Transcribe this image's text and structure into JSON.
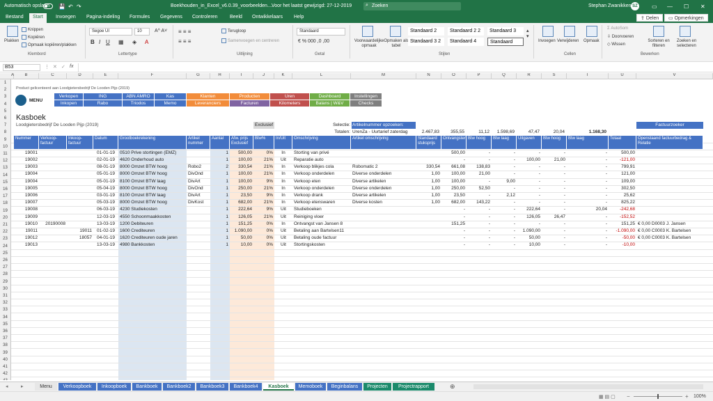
{
  "titlebar": {
    "autosave": "Automatisch opslaan",
    "filename": "Boekhouden_in_Excel_v6.0.39_voorbeelden....",
    "saved": "Voor het laatst gewijzigd: 27-12-2019",
    "search": "Zoeken",
    "user": "Stephan Zwanikken",
    "initials": "SZ"
  },
  "tabs": [
    "Bestand",
    "Start",
    "Invoegen",
    "Pagina-indeling",
    "Formules",
    "Gegevens",
    "Controleren",
    "Beeld",
    "Ontwikkelaars",
    "Help"
  ],
  "share_label": "Delen",
  "comments_label": "Opmerkingen",
  "ribbon": {
    "paste": "Plakken",
    "cut": "Knippen",
    "copy": "Kopiëren",
    "format_painter": "Opmaak kopiëren/plakken",
    "clipboard": "Klembord",
    "font_name": "Segoe UI",
    "font_size": "10",
    "font_group": "Lettertype",
    "wrap": "Terugloop",
    "merge": "Samenvoegen en centreren",
    "alignment_group": "Uitlijning",
    "number_format": "Standaard",
    "number_group": "Getal",
    "cond_format": "Voorwaardelijke opmaak",
    "format_table": "Opmaken als tabel",
    "styles": [
      "Standaard 2",
      "Standaard 2 2",
      "Standaard 3",
      "Standaard 3 2",
      "Standaard 4",
      "Standaard"
    ],
    "styles_group": "Stijlen",
    "insert": "Invoegen",
    "delete": "Verwijderen",
    "format": "Opmaak",
    "cells_group": "Cellen",
    "autosum": "AutoSom",
    "fill": "Doorvoeren",
    "clear": "Wissen",
    "sort": "Sorteren en filteren",
    "find": "Zoeken en selecteren",
    "editing_group": "Bewerken"
  },
  "namebox": "B53",
  "fx": "fx",
  "columns": [
    "A",
    "B",
    "C",
    "D",
    "E",
    "F",
    "G",
    "H",
    "I",
    "J",
    "K",
    "L",
    "M",
    "N",
    "O",
    "P",
    "Q",
    "R",
    "S",
    "T",
    "U",
    "V"
  ],
  "sheet": {
    "product_note": "Product gelicenteerd aan Loodgietersbedrijf De Looden Pijp (2019)",
    "menu_label": "MENU",
    "nav": [
      {
        "label": "Verkopen",
        "color": "#4472c4"
      },
      {
        "label": "ING",
        "color": "#4472c4"
      },
      {
        "label": "ABN AMRO",
        "color": "#4472c4"
      },
      {
        "label": "Kas",
        "color": "#4472c4"
      },
      {
        "label": "Klanten",
        "color": "#f28c3a"
      },
      {
        "label": "Producten",
        "color": "#f28c3a"
      },
      {
        "label": "Uren",
        "color": "#c0504d"
      },
      {
        "label": "Dashboard",
        "color": "#70ad47"
      },
      {
        "label": "Instellingen",
        "color": "#7f7f7f"
      },
      {
        "label": "Inkopen",
        "color": "#4472c4"
      },
      {
        "label": "Rabo",
        "color": "#4472c4"
      },
      {
        "label": "Triodos",
        "color": "#4472c4"
      },
      {
        "label": "Memo",
        "color": "#4472c4"
      },
      {
        "label": "Leveranciers",
        "color": "#f28c3a"
      },
      {
        "label": "Facturen",
        "color": "#8064a2"
      },
      {
        "label": "Kilometers",
        "color": "#c0504d"
      },
      {
        "label": "Balans | W&V",
        "color": "#70ad47"
      },
      {
        "label": "Checks",
        "color": "#7f7f7f"
      }
    ],
    "title": "Kasboek",
    "company": "Loodgietersbedrijf De Looden Pijp (2019)",
    "exclusief": "Exclusief",
    "selectie_label": "Selectie:",
    "selectie_value": "Artikelnummer opzoeken:",
    "totalen_label": "Totalen:",
    "totalen_value": "UrenZa - Uurtarief zaterdag",
    "totals": [
      "2.467,83",
      "355,55",
      "11,12",
      "1.598,69",
      "47,47",
      "20,04",
      "1.168,30"
    ],
    "factuurzoeker": "Factuurzoeker",
    "headers": [
      "Nummer",
      "Verkoop-factuur",
      "Inkoop-factuur",
      "Datum",
      "Grootboekrekening",
      "Artikel nummer",
      "Aantal",
      "Afw. prijs Exclusief",
      "Btw%",
      "In/Uit",
      "Omschrijving",
      "Artikel omschrijving",
      "Standaard stuksprijs",
      "Ontvangsten",
      "Btw hoog",
      "Btw laag",
      "Uitgaven",
      "Btw hoog",
      "Btw laag",
      "Totaal",
      "Openstaand factuurbedrag & Relatie"
    ],
    "rows": [
      [
        "19001",
        "",
        "",
        "01-01-19",
        "0510 Prive stortingen (EMZ)",
        "",
        "1",
        "500,00",
        "0%",
        "In",
        "Storting van privé",
        "",
        "",
        "500,00",
        "-",
        "-",
        "-",
        "-",
        "-",
        "500,00",
        ""
      ],
      [
        "19002",
        "",
        "",
        "02-01-19",
        "4620 Onderhoud auto",
        "",
        "1",
        "100,00",
        "21%",
        "Uit",
        "Reparatie auto",
        "",
        "",
        "-",
        "-",
        "-",
        "100,00",
        "21,00",
        "-",
        "-121,00",
        ""
      ],
      [
        "19003",
        "",
        "",
        "08-01-19",
        "8000 Omzet BTW hoog",
        "Robo2",
        "2",
        "330,54",
        "21%",
        "In",
        "Verkoop blikjes cola",
        "Robomatic 2",
        "330,54",
        "661,08",
        "138,83",
        "-",
        "-",
        "-",
        "-",
        "799,91",
        ""
      ],
      [
        "19004",
        "",
        "",
        "05-01-19",
        "8000 Omzet BTW hoog",
        "DivOnd",
        "1",
        "100,00",
        "21%",
        "In",
        "Verkoop onderdelen",
        "Diverse onderdelen",
        "1,00",
        "100,00",
        "21,00",
        "-",
        "-",
        "-",
        "-",
        "121,00",
        ""
      ],
      [
        "19004",
        "",
        "",
        "05-01-19",
        "8100 Omzet BTW laag",
        "DivArt",
        "1",
        "100,00",
        "9%",
        "In",
        "Verkoop eten",
        "Diverse artikelen",
        "1,00",
        "100,00",
        "-",
        "9,00",
        "-",
        "-",
        "-",
        "109,00",
        ""
      ],
      [
        "19005",
        "",
        "",
        "05-04-19",
        "8000 Omzet BTW hoog",
        "DivOnd",
        "1",
        "250,00",
        "21%",
        "In",
        "Verkoop onderdelen",
        "Diverse onderdelen",
        "1,00",
        "250,00",
        "52,50",
        "-",
        "-",
        "-",
        "-",
        "302,50",
        ""
      ],
      [
        "19006",
        "",
        "",
        "03-01-19",
        "8100 Omzet BTW laag",
        "DivArt",
        "1",
        "23,50",
        "9%",
        "In",
        "Verkoop drank",
        "Diverse artikelen",
        "1,00",
        "23,50",
        "-",
        "2,12",
        "-",
        "-",
        "-",
        "25,62",
        ""
      ],
      [
        "19007",
        "",
        "",
        "05-03-19",
        "8000 Omzet BTW hoog",
        "DivKost",
        "1",
        "682,00",
        "21%",
        "In",
        "Verkoop etenswaren",
        "Diverse kosten",
        "1,00",
        "682,00",
        "143,22",
        "-",
        "-",
        "-",
        "-",
        "825,22",
        ""
      ],
      [
        "19008",
        "",
        "",
        "06-03-19",
        "4230 Studiekosten",
        "",
        "1",
        "222,64",
        "9%",
        "Uit",
        "Studieboeken",
        "",
        "",
        "-",
        "-",
        "-",
        "222,64",
        "-",
        "20,04",
        "-242,68",
        ""
      ],
      [
        "19009",
        "",
        "",
        "12-03-19",
        "4550 Schoonmaakkosten",
        "",
        "1",
        "126,05",
        "21%",
        "Uit",
        "Reiniging vloer",
        "",
        "",
        "-",
        "-",
        "-",
        "126,05",
        "26,47",
        "-",
        "-152,52",
        ""
      ],
      [
        "19010",
        "20190008",
        "",
        "13-03-19",
        "1200 Debiteuren",
        "",
        "1",
        "151,25",
        "0%",
        "In",
        "Ontvangst van Jansen 8",
        "",
        "",
        "151,25",
        "-",
        "-",
        "-",
        "-",
        "-",
        "151,25",
        "€ 0,00 D0003 J. Jansen"
      ],
      [
        "19011",
        "",
        "19011",
        "01-02-19",
        "1600 Crediteuren",
        "",
        "1",
        "1.090,00",
        "0%",
        "Uit",
        "Betaling aan Bartelsen11",
        "",
        "",
        "-",
        "-",
        "-",
        "1.090,00",
        "-",
        "-",
        "-1.090,00",
        "€ 0,00 C0003 K. Bartelsen"
      ],
      [
        "19012",
        "",
        "18057",
        "04-01-19",
        "1620 Crediteuren oude jaren",
        "",
        "1",
        "50,00",
        "0%",
        "Uit",
        "Betaling oude factuur",
        "",
        "",
        "-",
        "-",
        "-",
        "50,00",
        "-",
        "-",
        "-50,00",
        "€ 0,00 C0003 K. Bartelsen"
      ],
      [
        "19013",
        "",
        "",
        "13-03-19",
        "4980 Bankkosten",
        "",
        "1",
        "10,00",
        "0%",
        "Uit",
        "Stortingskosten",
        "",
        "",
        "-",
        "-",
        "-",
        "10,00",
        "-",
        "-",
        "-10,00",
        ""
      ]
    ],
    "row_numbers": [
      "1",
      "2",
      "3",
      "4",
      "5",
      "6",
      "7",
      "8",
      "9",
      "10",
      "11",
      "12",
      "13",
      "14",
      "15",
      "16",
      "17",
      "18",
      "19",
      "20",
      "21",
      "22",
      "23",
      "24",
      "25",
      "26",
      "27",
      "28",
      "29",
      "30",
      "31",
      "32",
      "33",
      "34",
      "35",
      "36",
      "37",
      "38",
      "39",
      "40",
      "41",
      "42",
      "43",
      "44",
      "45",
      "46",
      "47"
    ]
  },
  "sheet_tabs": [
    {
      "label": "Menu",
      "color": "#e7e7e7",
      "text": "#333"
    },
    {
      "label": "Verkoopboek",
      "color": "#4472c4",
      "text": "#fff"
    },
    {
      "label": "Inkoopboek",
      "color": "#4472c4",
      "text": "#fff"
    },
    {
      "label": "Bankboek",
      "color": "#4472c4",
      "text": "#fff"
    },
    {
      "label": "Bankboek2",
      "color": "#4472c4",
      "text": "#fff"
    },
    {
      "label": "Bankboek3",
      "color": "#4472c4",
      "text": "#fff"
    },
    {
      "label": "Bankboek4",
      "color": "#4472c4",
      "text": "#fff"
    },
    {
      "label": "Kasboek",
      "color": "#ffffff",
      "text": "#217346"
    },
    {
      "label": "Memoboek",
      "color": "#4472c4",
      "text": "#fff"
    },
    {
      "label": "Beginbalans",
      "color": "#4472c4",
      "text": "#fff"
    },
    {
      "label": "Projecten",
      "color": "#1b8a6b",
      "text": "#fff"
    },
    {
      "label": "Projectrapport",
      "color": "#1b8a6b",
      "text": "#fff"
    }
  ],
  "status": {
    "zoom": "100%"
  },
  "colors": {
    "accent": "#217346",
    "blue": "#4472c4",
    "negative": "#c00000"
  }
}
